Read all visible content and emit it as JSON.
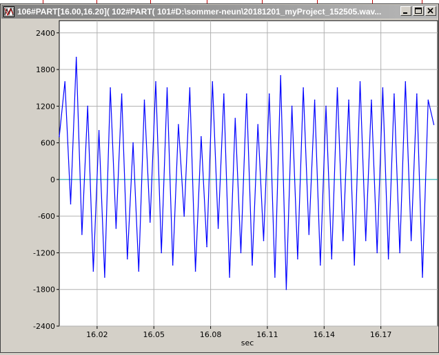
{
  "window": {
    "title": "106#PART[16.00,16.20]( 102#PART( 101#D:\\sommer-neun\\20181201_myProject_152505.wav...",
    "icon": "waveform-app-icon",
    "buttons": {
      "minimize": "minimize-icon",
      "maximize": "maximize-icon",
      "close": "close-icon"
    }
  },
  "colors": {
    "signal": "#0000ff",
    "zero_line": "#00a0a0",
    "grid": "#b0b0b0",
    "plot_bg": "#ffffff",
    "title_bar": "#808080"
  },
  "chart_data": {
    "type": "line",
    "title": "",
    "xlabel": "sec",
    "ylabel": "",
    "xlim": [
      16.0,
      16.2
    ],
    "ylim": [
      -2400,
      2600
    ],
    "grid": true,
    "xticks": [
      16.02,
      16.05,
      16.08,
      16.11,
      16.14,
      16.17
    ],
    "xtick_labels": [
      "16.02",
      "16.05",
      "16.08",
      "16.11",
      "16.14",
      "16.17"
    ],
    "yticks": [
      2400,
      1800,
      1200,
      600,
      0,
      -600,
      -1200,
      -1800,
      -2400
    ],
    "ytick_labels": [
      "2400",
      "1800",
      "1200",
      "600",
      "0",
      "-600",
      "-1200",
      "-1800",
      "-2400"
    ],
    "series": [
      {
        "color": "#0000ff",
        "x": [
          16.0,
          16.003,
          16.006,
          16.009,
          16.012,
          16.015,
          16.018,
          16.021,
          16.024,
          16.027,
          16.03,
          16.033,
          16.036,
          16.039,
          16.042,
          16.045,
          16.048,
          16.051,
          16.054,
          16.057,
          16.06,
          16.063,
          16.066,
          16.069,
          16.072,
          16.075,
          16.078,
          16.081,
          16.084,
          16.087,
          16.09,
          16.093,
          16.096,
          16.099,
          16.102,
          16.105,
          16.108,
          16.111,
          16.114,
          16.117,
          16.12,
          16.123,
          16.126,
          16.129,
          16.132,
          16.135,
          16.138,
          16.141,
          16.144,
          16.147,
          16.15,
          16.153,
          16.156,
          16.159,
          16.162,
          16.165,
          16.168,
          16.171,
          16.174,
          16.177,
          16.18,
          16.183,
          16.186,
          16.189,
          16.192,
          16.195,
          16.198
        ],
        "y": [
          700,
          1600,
          -400,
          2000,
          -900,
          1200,
          -1500,
          800,
          -1600,
          1500,
          -800,
          1400,
          -1300,
          600,
          -1500,
          1300,
          -700,
          1600,
          -1200,
          1500,
          -1400,
          900,
          -600,
          1500,
          -1500,
          700,
          -1100,
          1600,
          -800,
          1400,
          -1600,
          1000,
          -1200,
          1400,
          -1400,
          900,
          -1000,
          1400,
          -1600,
          1700,
          -1800,
          1200,
          -1300,
          1500,
          -900,
          1300,
          -1400,
          1200,
          -1300,
          1500,
          -1000,
          1300,
          -1400,
          1600,
          -1000,
          1300,
          -1200,
          1500,
          -1300,
          1400,
          -1200,
          1600,
          -1000,
          1400,
          -1600,
          1300,
          900
        ]
      }
    ]
  }
}
